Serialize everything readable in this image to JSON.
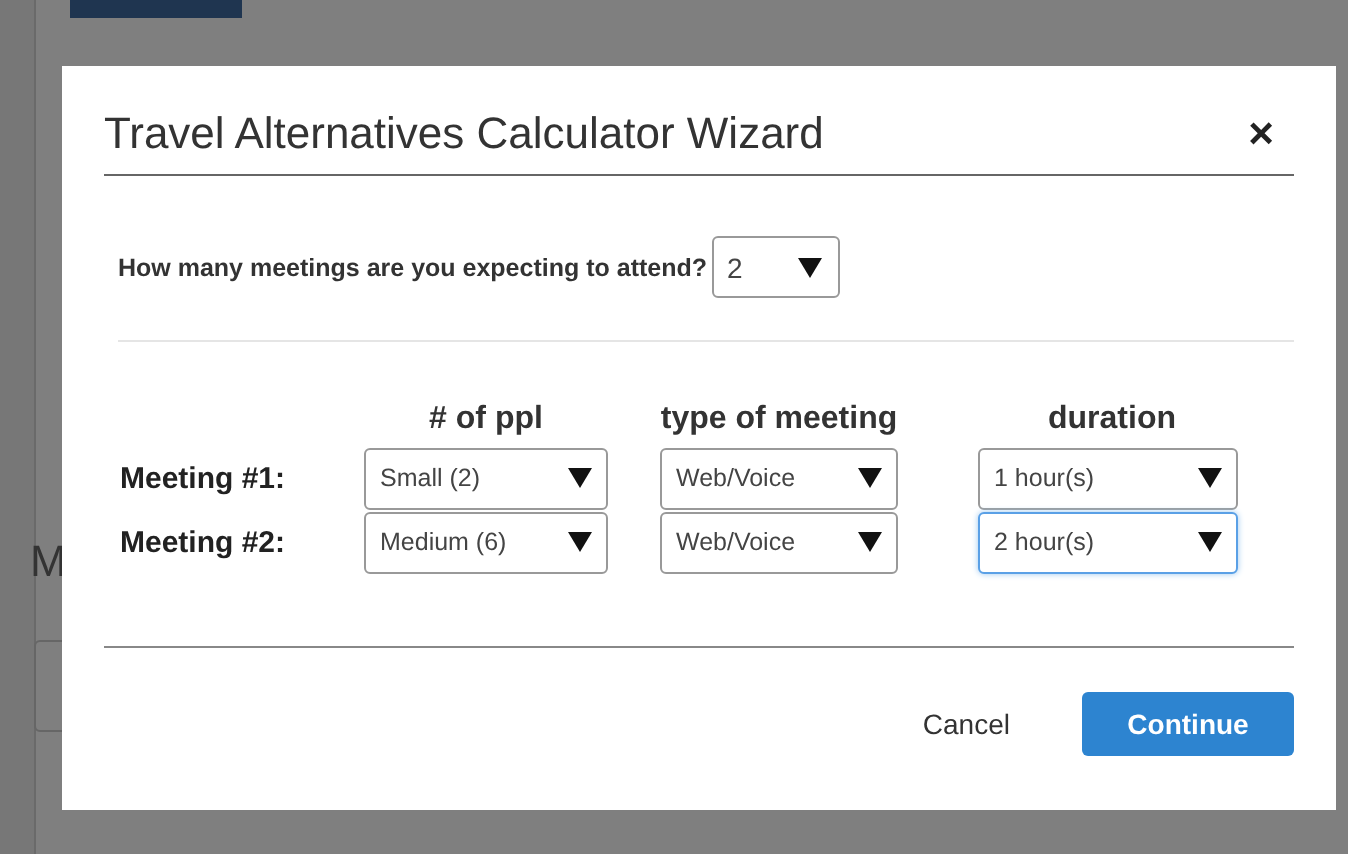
{
  "background": {
    "heading": "M"
  },
  "dialog": {
    "title": "Travel Alternatives Calculator Wizard",
    "close": "×",
    "question": {
      "label": "How many meetings are you expecting to attend?",
      "value": "2"
    },
    "columns": [
      "# of ppl",
      "type of meeting",
      "duration"
    ],
    "meetings": [
      {
        "label": "Meeting #1:",
        "fields": [
          {
            "value": "Small (2)",
            "focused": false
          },
          {
            "value": "Web/Voice",
            "focused": false
          },
          {
            "value": "1 hour(s)",
            "focused": false
          }
        ]
      },
      {
        "label": "Meeting #2:",
        "fields": [
          {
            "value": "Medium (6)",
            "focused": false
          },
          {
            "value": "Web/Voice",
            "focused": false
          },
          {
            "value": "2 hour(s)",
            "focused": true
          }
        ]
      }
    ],
    "buttons": {
      "cancel": "Cancel",
      "continue": "Continue"
    }
  }
}
